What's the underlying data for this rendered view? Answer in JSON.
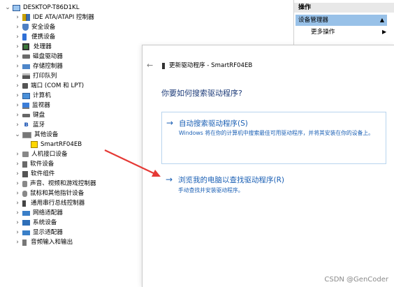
{
  "tree": {
    "root": "DESKTOP-T86D1KL",
    "items": [
      {
        "label": "IDE ATA/ATAPI 控制器",
        "icon": "ide-icon"
      },
      {
        "label": "安全设备",
        "icon": "shield-icon"
      },
      {
        "label": "便携设备",
        "icon": "portable-device-icon"
      },
      {
        "label": "处理器",
        "icon": "cpu-icon"
      },
      {
        "label": "磁盘驱动器",
        "icon": "disk-icon"
      },
      {
        "label": "存储控制器",
        "icon": "storage-icon"
      },
      {
        "label": "打印队列",
        "icon": "printer-icon"
      },
      {
        "label": "端口 (COM 和 LPT)",
        "icon": "port-icon"
      },
      {
        "label": "计算机",
        "icon": "computer-icon"
      },
      {
        "label": "监视器",
        "icon": "monitor-icon"
      },
      {
        "label": "键盘",
        "icon": "keyboard-icon"
      },
      {
        "label": "蓝牙",
        "icon": "bluetooth-icon"
      },
      {
        "label": "其他设备",
        "icon": "other-devices-icon"
      },
      {
        "label": "SmartRF04EB",
        "icon": "warning-device-icon"
      },
      {
        "label": "人机接口设备",
        "icon": "hid-icon"
      },
      {
        "label": "软件设备",
        "icon": "software-device-icon"
      },
      {
        "label": "软件组件",
        "icon": "software-component-icon"
      },
      {
        "label": "声音、视频和游戏控制器",
        "icon": "audio-icon"
      },
      {
        "label": "鼠标和其他指针设备",
        "icon": "mouse-icon"
      },
      {
        "label": "通用串行总线控制器",
        "icon": "usb-icon"
      },
      {
        "label": "网络适配器",
        "icon": "network-icon"
      },
      {
        "label": "系统设备",
        "icon": "system-icon"
      },
      {
        "label": "显示适配器",
        "icon": "display-icon"
      },
      {
        "label": "音频输入和输出",
        "icon": "sound-io-icon"
      }
    ]
  },
  "actions": {
    "header": "操作",
    "selected": "设备管理器",
    "more": "更多操作"
  },
  "wizard": {
    "title": "更新驱动程序 - SmartRF04EB",
    "question": "你要如何搜索驱动程序?",
    "option1_title": "自动搜索驱动程序(S)",
    "option1_desc": "Windows 将在你的计算机中搜索最佳可用驱动程序，并将其安装在你的设备上。",
    "option2_title": "浏览我的电脑以查找驱动程序(R)",
    "option2_desc": "手动查找并安装驱动程序。"
  },
  "watermark": "CSDN @GenCoder",
  "colors": {
    "link": "#1a5fb4",
    "selection": "#98c1e8",
    "annotation": "#e53935"
  }
}
